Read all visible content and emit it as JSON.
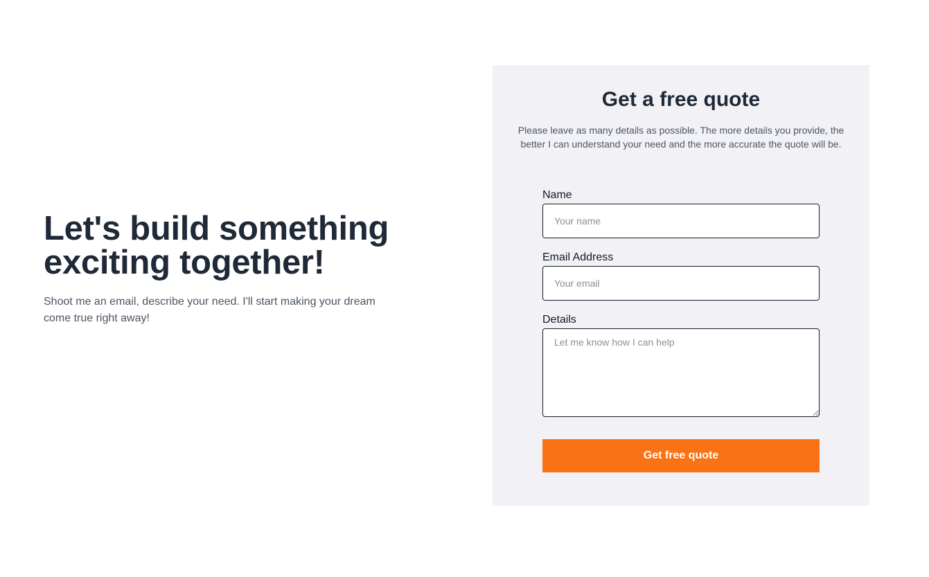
{
  "intro": {
    "heading": "Let's build something exciting together!",
    "text": "Shoot me an email, describe your need. I'll start making your dream come true right away!"
  },
  "quote_form": {
    "title": "Get a free quote",
    "description": "Please leave as many details as possible. The more details you provide, the better I can understand your need and the more accurate the quote will be.",
    "name": {
      "label": "Name",
      "placeholder": "Your name",
      "value": ""
    },
    "email": {
      "label": "Email Address",
      "placeholder": "Your email",
      "value": ""
    },
    "details": {
      "label": "Details",
      "placeholder": "Let me know how I can help",
      "value": ""
    },
    "submit_label": "Get free quote"
  },
  "colors": {
    "accent": "#f97316",
    "panel_background": "#f2f2f6",
    "heading_text": "#1f2937"
  }
}
